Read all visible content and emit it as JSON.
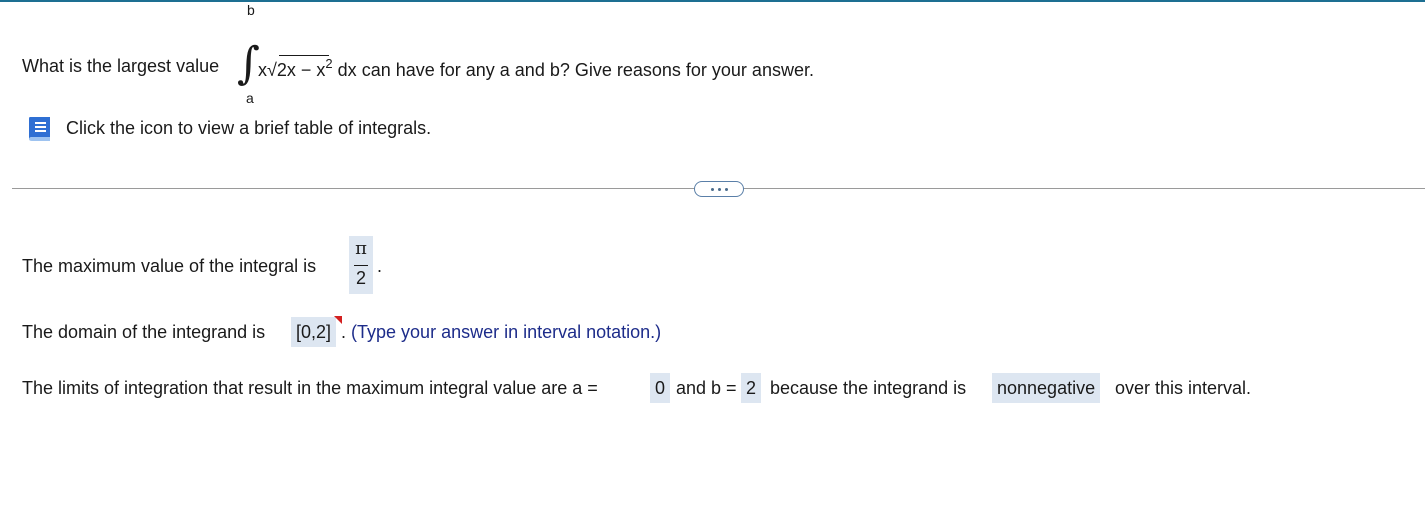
{
  "colors": {
    "top_border": "#1d6f92",
    "answer_box_bg": "#dde6f1",
    "hint_text": "#1d2c8a",
    "flag": "#d32020"
  },
  "question": {
    "prefix": "What is the largest value",
    "upper_limit": "b",
    "lower_limit": "a",
    "integrand_x": "x",
    "sqrt_content": "2x − x",
    "sqrt_exponent": "2",
    "differential": "dx",
    "suffix": "can have for any a and b? Give reasons for your answer."
  },
  "help": {
    "icon": "book-icon",
    "text": "Click the icon to view a brief table of integrals."
  },
  "divider": {
    "more_icon": "ellipsis-icon"
  },
  "answers": {
    "max_value_label": "The maximum value of the integral is",
    "max_value_numerator": "π",
    "max_value_denominator": "2",
    "period": ".",
    "domain_label": "The domain of the integrand is",
    "domain_value": "[0,2]",
    "domain_after": ".",
    "domain_hint": "(Type your answer in interval notation.)",
    "limits_label": "The limits of integration that result in the maximum integral value are a =",
    "a_value": "0",
    "and_b": "and b =",
    "b_value": "2",
    "because": "because the integrand is",
    "reason_value": "nonnegative",
    "tail": "over this interval."
  }
}
